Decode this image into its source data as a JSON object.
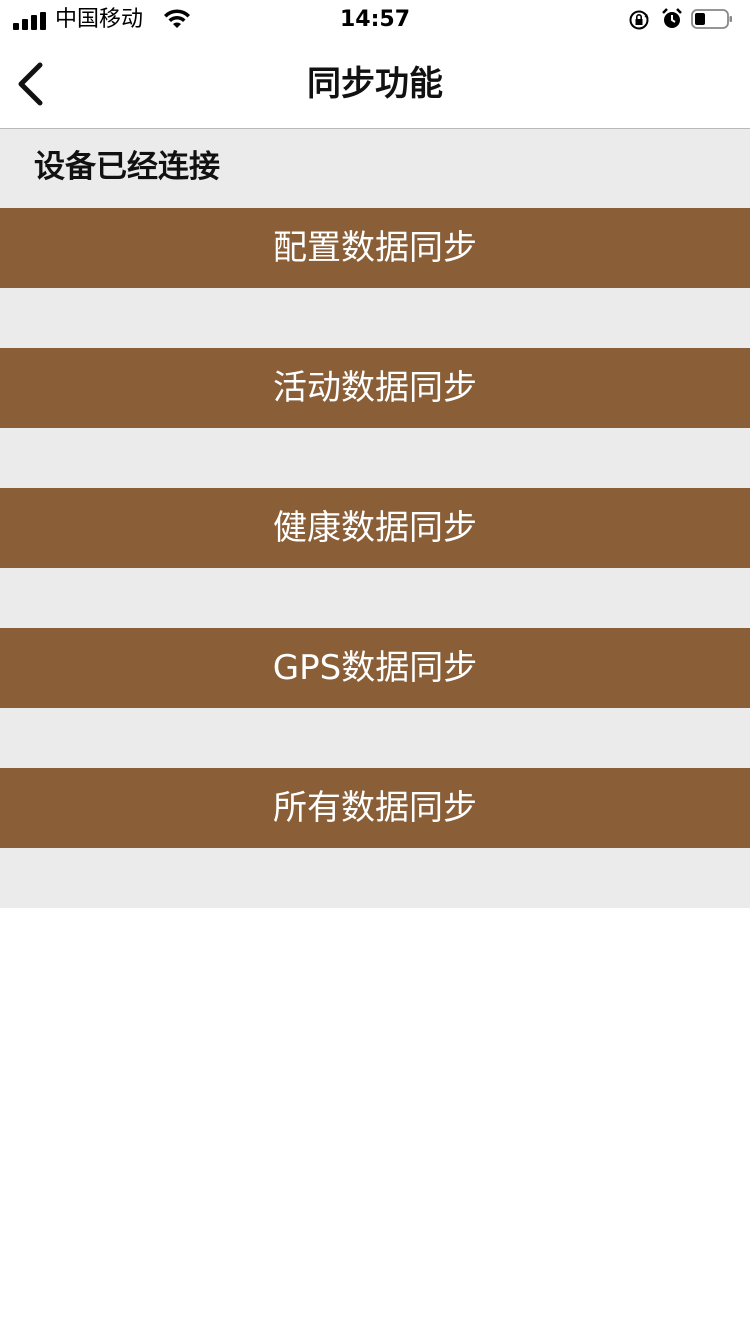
{
  "status_bar": {
    "carrier": "中国移动",
    "time": "14:57"
  },
  "nav": {
    "title": "同步功能"
  },
  "connection": {
    "status": "设备已经连接"
  },
  "sync_buttons": [
    {
      "label": "配置数据同步"
    },
    {
      "label": "活动数据同步"
    },
    {
      "label": "健康数据同步"
    },
    {
      "label": "GPS数据同步"
    },
    {
      "label": "所有数据同步"
    }
  ],
  "colors": {
    "button_bg": "#8a5e36",
    "content_bg": "#ebebeb"
  }
}
